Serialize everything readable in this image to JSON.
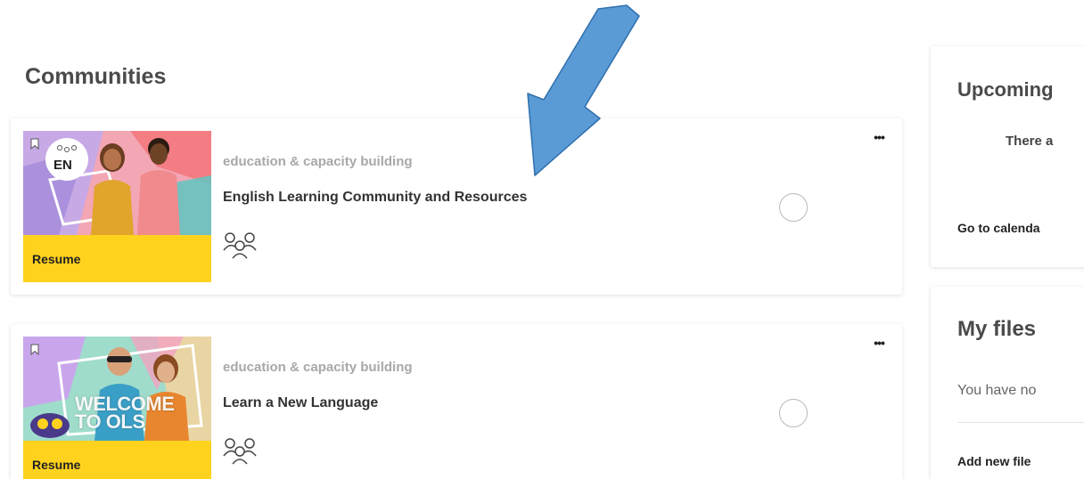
{
  "main": {
    "section_title": "Communities",
    "cards": [
      {
        "category": "education & capacity building",
        "title": "English Learning Community and Resources",
        "resume_label": "Resume",
        "more_label": "•••",
        "badge_text": "EN"
      },
      {
        "category": "education & capacity building",
        "title": "Learn a New Language",
        "resume_label": "Resume",
        "more_label": "•••",
        "thumb_text": "WELCOME TO OLS"
      }
    ]
  },
  "sidebar": {
    "upcoming": {
      "title": "Upcoming",
      "empty_text": "There a",
      "calendar_link": "Go to calenda"
    },
    "files": {
      "title": "My files",
      "empty_text": "You have no",
      "add_link": "Add new file"
    }
  },
  "colors": {
    "resume_bar": "#ffd21e",
    "arrow": "#5b9bd5",
    "category_text": "#a8a8a8"
  },
  "icons": [
    "bookmark-icon",
    "group-icon",
    "more-icon",
    "progress-circle-icon",
    "arrow-annotation"
  ]
}
